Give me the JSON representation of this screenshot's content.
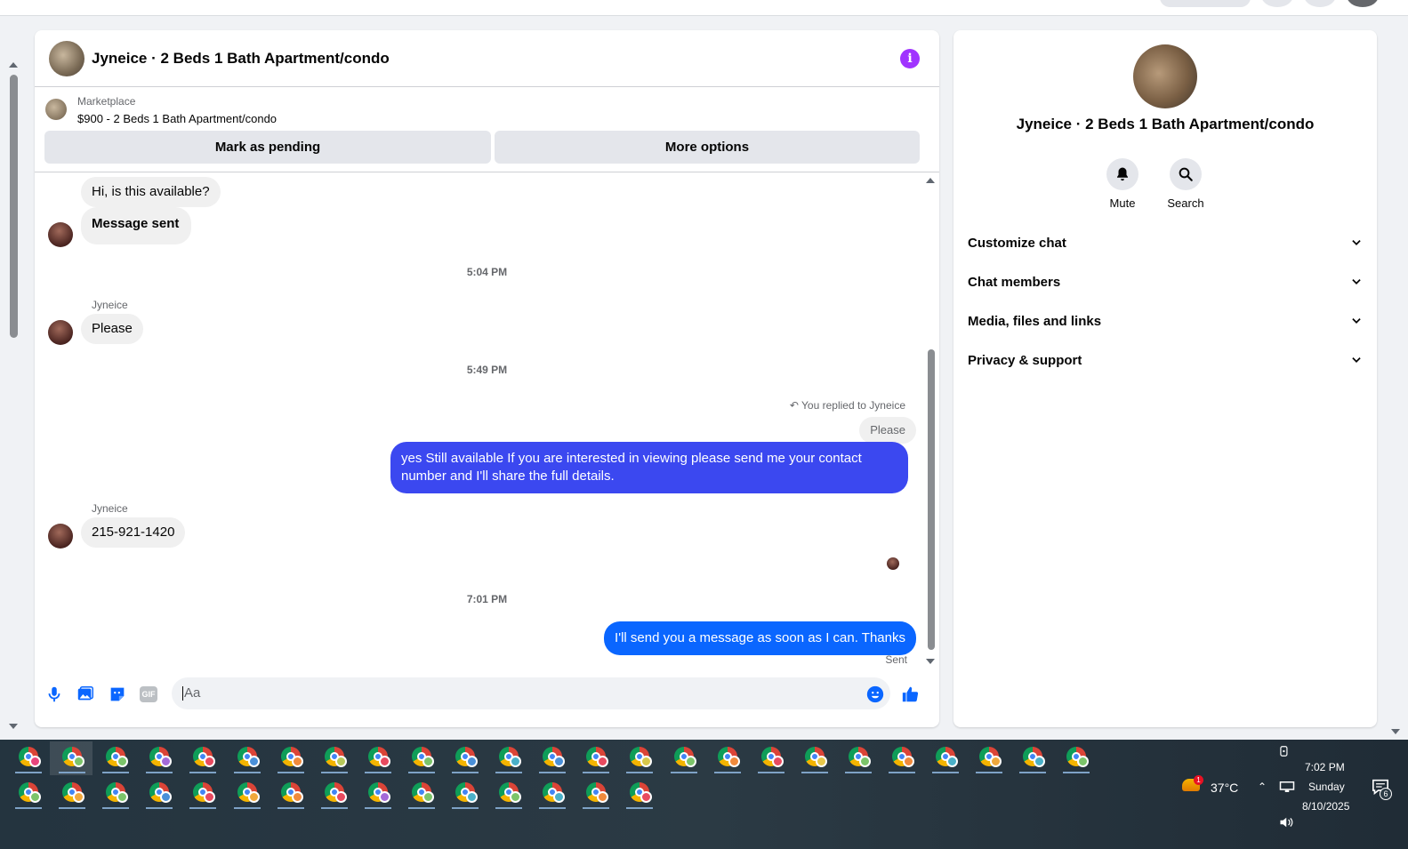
{
  "chat": {
    "title": "Jyneice · 2 Beds 1 Bath Apartment/condo",
    "info_icon": "info-icon",
    "marketplace_label": "Marketplace",
    "listing": "$900 - 2 Beds 1 Bath Apartment/condo",
    "mark_pending": "Mark as pending",
    "more_options": "More options"
  },
  "messages": {
    "m1": "Hi, is this available?",
    "m2": "Message sent",
    "t1": "5:04 PM",
    "sender1": "Jyneice",
    "m3": "Please",
    "t2": "5:49 PM",
    "replied": "You replied to Jyneice",
    "quoted": "Please",
    "m4": "yes Still available If you are interested in viewing please send me your contact number and I'll share the full details.",
    "sender2": "Jyneice",
    "m5": "215-921-1420",
    "t3": "7:01 PM",
    "m6": "I'll send you a message as soon as I can. Thanks",
    "status": "Sent"
  },
  "composer": {
    "placeholder": "Aa",
    "icons": [
      "microphone-icon",
      "photo-icon",
      "sticker-icon",
      "gif-icon",
      "emoji-icon",
      "like-icon"
    ],
    "gif_label": "GIF"
  },
  "side": {
    "name": "Jyneice · 2 Beds 1 Bath Apartment/condo",
    "mute": "Mute",
    "search": "Search",
    "sections": [
      "Customize chat",
      "Chat members",
      "Media, files and links",
      "Privacy & support"
    ]
  },
  "taskbar": {
    "weather": "37°C",
    "weather_badge": "1",
    "time": "7:02 PM",
    "day": "Sunday",
    "date": "8/10/2025",
    "notif_count": "6",
    "row1_badges": [
      "#e8457c",
      "#7cc46a",
      "#7cc46a",
      "#a46ad8",
      "#e84a5f",
      "#4a90d9",
      "#f08a3c",
      "#b8c95a",
      "#e84a5f",
      "#7cc46a",
      "#4a90d9",
      "#4ab0c8",
      "#4a90d9",
      "#e84a5f",
      "#d8c84a",
      "#7cc46a",
      "#f08a3c",
      "#e84a5f",
      "#e8c84a",
      "#7cc46a",
      "#f08a3c",
      "#4ab0c8",
      "#f0a83c",
      "#4ab0c8",
      "#7cc46a"
    ],
    "row2_badges": [
      "#7cc46a",
      "#f0a83c",
      "#7cc46a",
      "#4a90d9",
      "#e84a5f",
      "#f0a83c",
      "#f08a3c",
      "#e84a5f",
      "#a46ad8",
      "#7cc46a",
      "#4ab0c8",
      "#7cc46a",
      "#4ab0c8",
      "#f08a3c",
      "#e84a5f"
    ]
  }
}
